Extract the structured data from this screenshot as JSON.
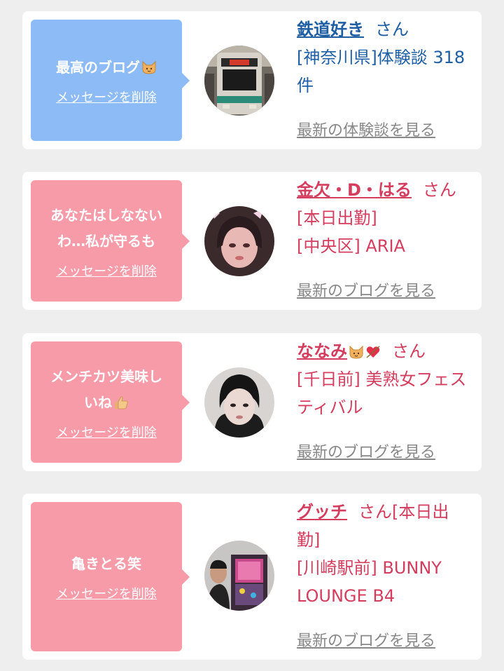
{
  "colors": {
    "blue_bubble": "#8cbbf5",
    "pink_bubble": "#f89ba9",
    "blue_text": "#1e5ea3",
    "pink_text": "#d43d5e",
    "gray_link": "#888888"
  },
  "cards": [
    {
      "bubble_message": "最高のブログ",
      "bubble_icon": "cat-face-icon",
      "delete_label": "メッセージを削除",
      "user_name": "鉄道好き",
      "honorific": "さん",
      "lines": [
        "[神奈川県]体験談 318",
        "件"
      ],
      "latest_link": "最新の体験談を見る",
      "avatar": "train-photo"
    },
    {
      "bubble_message": "あなたはしなない\nわ…私が守るも",
      "delete_label": "メッセージを削除",
      "user_name": "金欠・D・はる",
      "honorific": "さん",
      "lines": [
        "[本日出勤]",
        "[中央区] ARIA"
      ],
      "latest_link": "最新のブログを見る",
      "avatar": "selfie-photo"
    },
    {
      "bubble_message": "メンチカツ美味し\nいね",
      "bubble_icon": "thumbs-up-icon",
      "delete_label": "メッセージを削除",
      "user_name": "ななみ",
      "user_icons": [
        "cat-face-icon",
        "heart-arrow-icon"
      ],
      "honorific": "さん",
      "lines": [
        "[千日前] 美熟女フェス",
        "ティバル"
      ],
      "latest_link": "最新のブログを見る",
      "avatar": "portrait-photo"
    },
    {
      "bubble_message": "亀きとる笑",
      "delete_label": "メッセージを削除",
      "user_name": "グッチ",
      "honorific": "さん[本日出",
      "lines": [
        "勤]",
        "[川崎駅前] BUNNY",
        "LOUNGE B4"
      ],
      "latest_link": "最新のブログを見る",
      "avatar": "arcade-photo"
    }
  ]
}
